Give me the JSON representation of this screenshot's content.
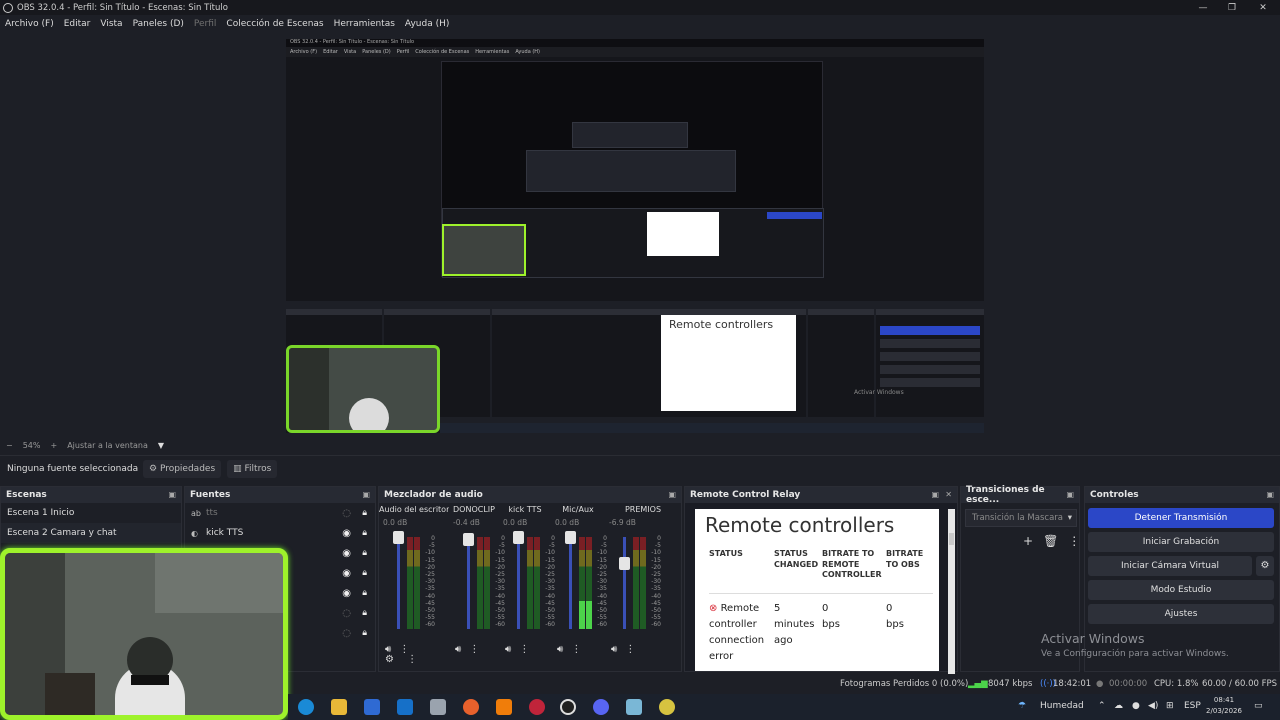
{
  "window": {
    "title": "OBS 32.0.4 - Perfil: Sin Título - Escenas: Sin Título",
    "minimize_glyph": "—",
    "restore_glyph": "❐",
    "close_glyph": "✕"
  },
  "menu": [
    "Archivo (F)",
    "Editar",
    "Vista",
    "Paneles (D)",
    "Perfil",
    "Colección de Escenas",
    "Herramientas",
    "Ayuda (H)"
  ],
  "preview": {
    "nested_title": "OBS 32.0.4 - Perfil: Sin Título - Escenas: Sin Título",
    "nested_menu": [
      "Archivo (F)",
      "Editar",
      "Vista",
      "Paneles (D)",
      "Perfil",
      "Colección de Escenas",
      "Herramientas",
      "Ayuda (H)"
    ],
    "nested_rc_title": "Remote controllers",
    "nested_activate": "Activar Windows"
  },
  "zoom": {
    "minus": "−",
    "level": "54%",
    "plus": "+",
    "fit": "Ajustar a la ventana",
    "caret": "▼"
  },
  "source_toolbar": {
    "no_source": "Ninguna fuente seleccionada",
    "properties": "Propiedades",
    "filters": "Filtros"
  },
  "scenes": {
    "title": "Escenas",
    "items": [
      "Escena 1 Inicio",
      "Escena 2 Camara y chat"
    ]
  },
  "sources": {
    "title": "Fuentes",
    "items": [
      {
        "label": "tts",
        "type": "ab"
      },
      {
        "label": "kick TTS",
        "type": "◐"
      }
    ]
  },
  "mixer": {
    "title": "Mezclador de audio",
    "channels": [
      {
        "name": "Audio del escritorio",
        "db": "0.0 dB",
        "level": 0
      },
      {
        "name": "DONOCLIP",
        "db": "-0.4 dB",
        "level": 0
      },
      {
        "name": "kick  TTS",
        "db": "0.0 dB",
        "level": 0
      },
      {
        "name": "Mic/Aux",
        "db": "0.0 dB",
        "level": 0.3
      },
      {
        "name": "PREMIOS",
        "db": "-6.9 dB",
        "level": 0
      }
    ],
    "scale": [
      "0",
      "-5",
      "-10",
      "-15",
      "-20",
      "-25",
      "-30",
      "-35",
      "-40",
      "-45",
      "-50",
      "-55",
      "-60"
    ]
  },
  "remote": {
    "dock_title": "Remote Control Relay",
    "title": "Remote controllers",
    "headers": [
      "STATUS",
      "STATUS CHANGED",
      "BITRATE TO REMOTE CONTROLLER",
      "BITRATE TO OBS"
    ],
    "row": {
      "status": "Remote controller connection error",
      "changed": "5 minutes ago",
      "bitrate_remote": "0 bps",
      "bitrate_obs": "0 bps"
    }
  },
  "transitions": {
    "title": "Transiciones de esce...",
    "selected": "Transición la Mascara"
  },
  "controls": {
    "title": "Controles",
    "stop_stream": "Detener Transmisión",
    "start_record": "Iniciar Grabación",
    "start_vcam": "Iniciar Cámara Virtual",
    "studio": "Modo Estudio",
    "settings": "Ajustes"
  },
  "activate": {
    "line1": "Activar Windows",
    "line2": "Ve a Configuración para activar Windows."
  },
  "status": {
    "dropped": "Fotogramas Perdidos 0 (0.0%)",
    "kbps": "8047 kbps",
    "stream_time": "18:42:01",
    "rec_time": "00:00:00",
    "cpu": "CPU: 1.8%",
    "fps": "60.00 / 60.00 FPS"
  },
  "taskbar": {
    "weather": "Humedad",
    "lang": "ESP",
    "time": "08:41",
    "date": "2/03/2026"
  },
  "colors": {
    "accent": "#2b47c7",
    "webcam_border": "#9ef22b",
    "meter_green": "#4cd44a"
  }
}
